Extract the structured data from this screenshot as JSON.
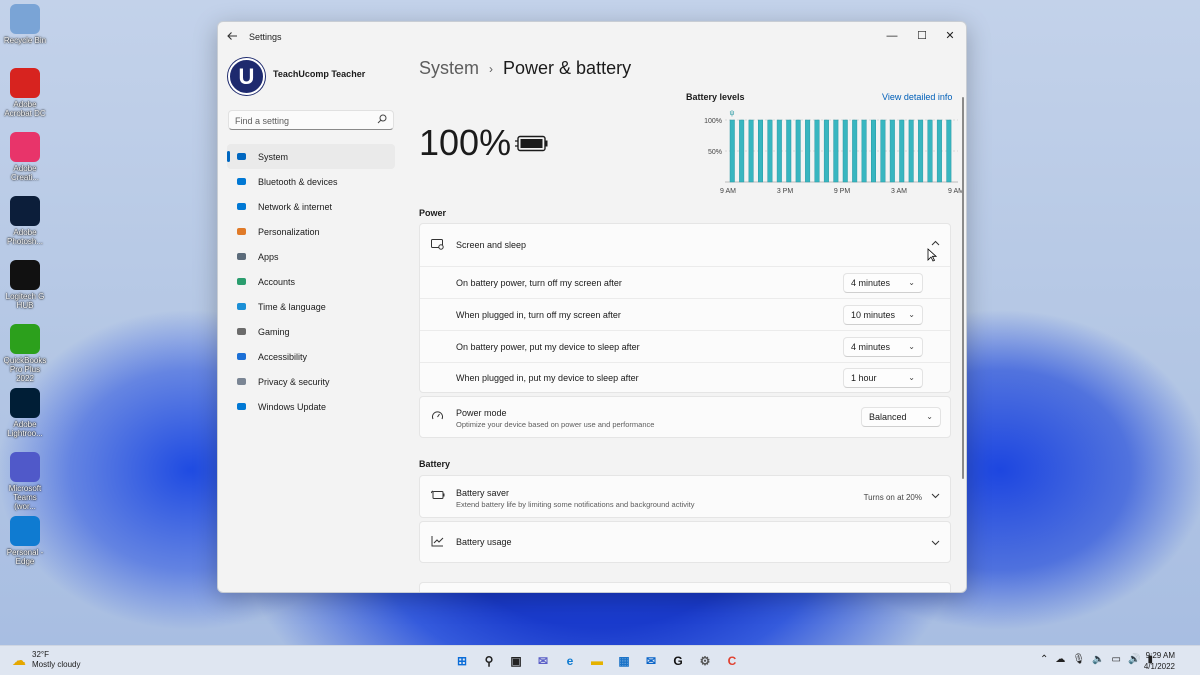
{
  "desktop": {
    "icons": [
      {
        "label": "Recycle Bin",
        "icon": "recycle-bin-icon",
        "color": "#7aa4d6"
      },
      {
        "label": "Adobe\nAcrobat DC",
        "icon": "adobe-acrobat-icon",
        "color": "#d7231f"
      },
      {
        "label": "Adobe\nCreati...",
        "icon": "adobe-creative-cloud-icon",
        "color": "#e8346a"
      },
      {
        "label": "Adobe\nPhotosh...",
        "icon": "adobe-photoshop-icon",
        "color": "#0c1e3a"
      },
      {
        "label": "Logitech G\nHUB",
        "icon": "logitech-g-hub-icon",
        "color": "#111111"
      },
      {
        "label": "QuickBooks\nPro Plus 2022",
        "icon": "quickbooks-icon",
        "color": "#2ca01c"
      },
      {
        "label": "Adobe\nLightroo...",
        "icon": "adobe-lightroom-icon",
        "color": "#001e36"
      },
      {
        "label": "Microsoft\nTeams (wor...",
        "icon": "microsoft-teams-icon",
        "color": "#5059c9"
      },
      {
        "label": "Personal -\nEdge",
        "icon": "edge-icon",
        "color": "#0f7bd1"
      }
    ]
  },
  "window": {
    "title": "Settings",
    "minimize": "—",
    "maximize": "☐",
    "close": "✕"
  },
  "sidebar": {
    "user_name": "TeachUcomp Teacher",
    "avatar_letter": "U",
    "search_placeholder": "Find a setting",
    "items": [
      {
        "label": "System",
        "icon": "system-icon",
        "color": "#0067c0",
        "active": true
      },
      {
        "label": "Bluetooth & devices",
        "icon": "bluetooth-icon",
        "color": "#0078d4"
      },
      {
        "label": "Network & internet",
        "icon": "wifi-icon",
        "color": "#0078d4"
      },
      {
        "label": "Personalization",
        "icon": "brush-icon",
        "color": "#e07a28"
      },
      {
        "label": "Apps",
        "icon": "apps-icon",
        "color": "#5b6b7a"
      },
      {
        "label": "Accounts",
        "icon": "accounts-icon",
        "color": "#2a9d6e"
      },
      {
        "label": "Time & language",
        "icon": "globe-icon",
        "color": "#1b8fd6"
      },
      {
        "label": "Gaming",
        "icon": "gaming-icon",
        "color": "#6b6b6b"
      },
      {
        "label": "Accessibility",
        "icon": "accessibility-icon",
        "color": "#1b6fd6"
      },
      {
        "label": "Privacy & security",
        "icon": "shield-icon",
        "color": "#7a8594"
      },
      {
        "label": "Windows Update",
        "icon": "windows-update-icon",
        "color": "#0078d4"
      }
    ]
  },
  "main": {
    "breadcrumb_parent": "System",
    "breadcrumb_sep": "›",
    "breadcrumb_current": "Power & battery",
    "battery_percent": "100%",
    "battery_levels_title": "Battery levels",
    "view_detailed_info": "View detailed info",
    "power_section": "Power",
    "screen_sleep_label": "Screen and sleep",
    "screen_sleep_rows": [
      {
        "label": "On battery power, turn off my screen after",
        "value": "4 minutes"
      },
      {
        "label": "When plugged in, turn off my screen after",
        "value": "10 minutes"
      },
      {
        "label": "On battery power, put my device to sleep after",
        "value": "4 minutes"
      },
      {
        "label": "When plugged in, put my device to sleep after",
        "value": "1 hour"
      }
    ],
    "power_mode_label": "Power mode",
    "power_mode_sub": "Optimize your device based on power use and performance",
    "power_mode_value": "Balanced",
    "battery_section": "Battery",
    "battery_saver_label": "Battery saver",
    "battery_saver_sub": "Extend battery life by limiting some notifications and background activity",
    "battery_saver_status": "Turns on at 20%",
    "battery_usage_label": "Battery usage"
  },
  "chart_data": {
    "type": "bar",
    "title": "Battery levels",
    "y_ticks": [
      "100%",
      "50%"
    ],
    "x_ticks": [
      "9 AM",
      "3 PM",
      "9 PM",
      "3 AM",
      "9 AM"
    ],
    "ylim": [
      0,
      100
    ],
    "values": [
      100,
      100,
      100,
      100,
      100,
      100,
      100,
      100,
      100,
      100,
      100,
      100,
      100,
      100,
      100,
      100,
      100,
      100,
      100,
      100,
      100,
      100,
      100,
      100
    ],
    "bar_color": "#38b6c0",
    "grid": true
  },
  "taskbar": {
    "weather_temp": "32°F",
    "weather_desc": "Mostly cloudy",
    "apps": [
      {
        "icon": "windows-start-icon",
        "glyph": "⊞",
        "color": "#0a6cd8"
      },
      {
        "icon": "search-icon",
        "glyph": "⚲",
        "color": "#222222"
      },
      {
        "icon": "task-view-icon",
        "glyph": "▣",
        "color": "#222222"
      },
      {
        "icon": "chat-icon",
        "glyph": "✉",
        "color": "#5b5fc7"
      },
      {
        "icon": "edge-icon",
        "glyph": "e",
        "color": "#0f7bd1"
      },
      {
        "icon": "file-explorer-icon",
        "glyph": "▬",
        "color": "#e5b200"
      },
      {
        "icon": "microsoft-store-icon",
        "glyph": "▦",
        "color": "#1a73c8"
      },
      {
        "icon": "mail-icon",
        "glyph": "✉",
        "color": "#0a64c8"
      },
      {
        "icon": "logitech-g-hub-icon",
        "glyph": "G",
        "color": "#111111"
      },
      {
        "icon": "settings-icon",
        "glyph": "⚙",
        "color": "#555555"
      },
      {
        "icon": "camtasia-icon",
        "glyph": "C",
        "color": "#e0402f"
      }
    ],
    "tray_icons": [
      "chevron-up-icon",
      "onedrive-icon",
      "microphone-icon",
      "speaker-icon",
      "display-icon",
      "volume-icon",
      "battery-icon"
    ],
    "time": "9:29 AM",
    "date": "4/1/2022"
  }
}
